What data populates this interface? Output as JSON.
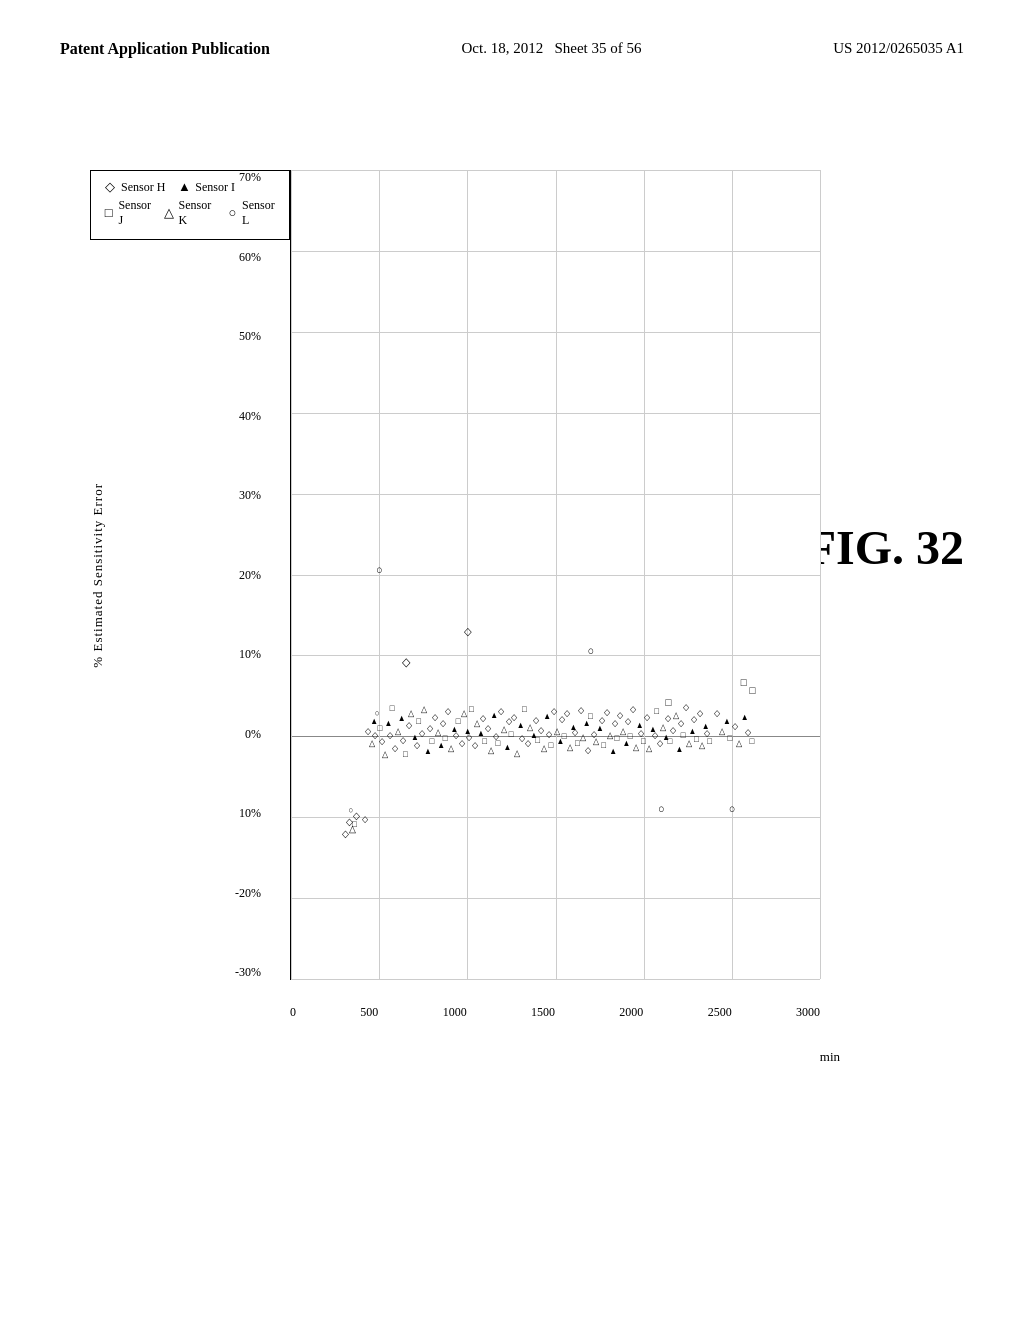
{
  "header": {
    "left": "Patent Application Publication",
    "date": "Oct. 18, 2012",
    "sheet": "Sheet 35 of 56",
    "patent": "US 2012/0265035 A1"
  },
  "figure": {
    "label": "FIG. 32"
  },
  "legend": {
    "items": [
      {
        "symbol": "◇",
        "label": "Sensor H"
      },
      {
        "symbol": "▲",
        "label": "Sensor I"
      },
      {
        "symbol": "□",
        "label": "Sensor J"
      },
      {
        "symbol": "△",
        "label": "Sensor K"
      },
      {
        "symbol": "○",
        "label": "Sensor L"
      }
    ]
  },
  "yAxis": {
    "title": "% Estimated Sensitivity Error",
    "labels": [
      "70%",
      "60%",
      "50%",
      "40%",
      "30%",
      "20%",
      "10%",
      "0%",
      "10%",
      "20%",
      "-30%"
    ]
  },
  "xAxis": {
    "labels": [
      "0",
      "500",
      "1000",
      "1500",
      "2000",
      "2500",
      "3000"
    ],
    "unit": "min"
  }
}
